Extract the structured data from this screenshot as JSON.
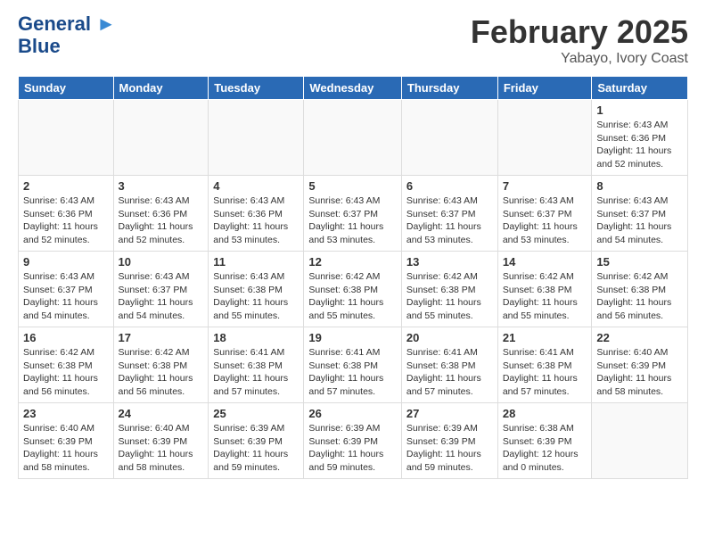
{
  "header": {
    "logo_line1": "General",
    "logo_line2": "Blue",
    "month": "February 2025",
    "location": "Yabayo, Ivory Coast"
  },
  "days_of_week": [
    "Sunday",
    "Monday",
    "Tuesday",
    "Wednesday",
    "Thursday",
    "Friday",
    "Saturday"
  ],
  "weeks": [
    [
      {
        "day": "",
        "info": ""
      },
      {
        "day": "",
        "info": ""
      },
      {
        "day": "",
        "info": ""
      },
      {
        "day": "",
        "info": ""
      },
      {
        "day": "",
        "info": ""
      },
      {
        "day": "",
        "info": ""
      },
      {
        "day": "1",
        "info": "Sunrise: 6:43 AM\nSunset: 6:36 PM\nDaylight: 11 hours\nand 52 minutes."
      }
    ],
    [
      {
        "day": "2",
        "info": "Sunrise: 6:43 AM\nSunset: 6:36 PM\nDaylight: 11 hours\nand 52 minutes."
      },
      {
        "day": "3",
        "info": "Sunrise: 6:43 AM\nSunset: 6:36 PM\nDaylight: 11 hours\nand 52 minutes."
      },
      {
        "day": "4",
        "info": "Sunrise: 6:43 AM\nSunset: 6:36 PM\nDaylight: 11 hours\nand 53 minutes."
      },
      {
        "day": "5",
        "info": "Sunrise: 6:43 AM\nSunset: 6:37 PM\nDaylight: 11 hours\nand 53 minutes."
      },
      {
        "day": "6",
        "info": "Sunrise: 6:43 AM\nSunset: 6:37 PM\nDaylight: 11 hours\nand 53 minutes."
      },
      {
        "day": "7",
        "info": "Sunrise: 6:43 AM\nSunset: 6:37 PM\nDaylight: 11 hours\nand 53 minutes."
      },
      {
        "day": "8",
        "info": "Sunrise: 6:43 AM\nSunset: 6:37 PM\nDaylight: 11 hours\nand 54 minutes."
      }
    ],
    [
      {
        "day": "9",
        "info": "Sunrise: 6:43 AM\nSunset: 6:37 PM\nDaylight: 11 hours\nand 54 minutes."
      },
      {
        "day": "10",
        "info": "Sunrise: 6:43 AM\nSunset: 6:37 PM\nDaylight: 11 hours\nand 54 minutes."
      },
      {
        "day": "11",
        "info": "Sunrise: 6:43 AM\nSunset: 6:38 PM\nDaylight: 11 hours\nand 55 minutes."
      },
      {
        "day": "12",
        "info": "Sunrise: 6:42 AM\nSunset: 6:38 PM\nDaylight: 11 hours\nand 55 minutes."
      },
      {
        "day": "13",
        "info": "Sunrise: 6:42 AM\nSunset: 6:38 PM\nDaylight: 11 hours\nand 55 minutes."
      },
      {
        "day": "14",
        "info": "Sunrise: 6:42 AM\nSunset: 6:38 PM\nDaylight: 11 hours\nand 55 minutes."
      },
      {
        "day": "15",
        "info": "Sunrise: 6:42 AM\nSunset: 6:38 PM\nDaylight: 11 hours\nand 56 minutes."
      }
    ],
    [
      {
        "day": "16",
        "info": "Sunrise: 6:42 AM\nSunset: 6:38 PM\nDaylight: 11 hours\nand 56 minutes."
      },
      {
        "day": "17",
        "info": "Sunrise: 6:42 AM\nSunset: 6:38 PM\nDaylight: 11 hours\nand 56 minutes."
      },
      {
        "day": "18",
        "info": "Sunrise: 6:41 AM\nSunset: 6:38 PM\nDaylight: 11 hours\nand 57 minutes."
      },
      {
        "day": "19",
        "info": "Sunrise: 6:41 AM\nSunset: 6:38 PM\nDaylight: 11 hours\nand 57 minutes."
      },
      {
        "day": "20",
        "info": "Sunrise: 6:41 AM\nSunset: 6:38 PM\nDaylight: 11 hours\nand 57 minutes."
      },
      {
        "day": "21",
        "info": "Sunrise: 6:41 AM\nSunset: 6:38 PM\nDaylight: 11 hours\nand 57 minutes."
      },
      {
        "day": "22",
        "info": "Sunrise: 6:40 AM\nSunset: 6:39 PM\nDaylight: 11 hours\nand 58 minutes."
      }
    ],
    [
      {
        "day": "23",
        "info": "Sunrise: 6:40 AM\nSunset: 6:39 PM\nDaylight: 11 hours\nand 58 minutes."
      },
      {
        "day": "24",
        "info": "Sunrise: 6:40 AM\nSunset: 6:39 PM\nDaylight: 11 hours\nand 58 minutes."
      },
      {
        "day": "25",
        "info": "Sunrise: 6:39 AM\nSunset: 6:39 PM\nDaylight: 11 hours\nand 59 minutes."
      },
      {
        "day": "26",
        "info": "Sunrise: 6:39 AM\nSunset: 6:39 PM\nDaylight: 11 hours\nand 59 minutes."
      },
      {
        "day": "27",
        "info": "Sunrise: 6:39 AM\nSunset: 6:39 PM\nDaylight: 11 hours\nand 59 minutes."
      },
      {
        "day": "28",
        "info": "Sunrise: 6:38 AM\nSunset: 6:39 PM\nDaylight: 12 hours\nand 0 minutes."
      },
      {
        "day": "",
        "info": ""
      }
    ]
  ]
}
